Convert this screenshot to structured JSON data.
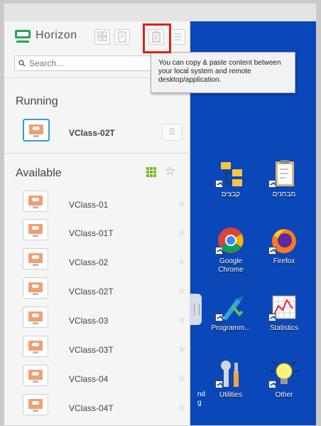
{
  "brand": {
    "name": "Horizon"
  },
  "search": {
    "placeholder": "Search..."
  },
  "tooltip": {
    "text": "You can copy & paste content between your local system and remote desktop/application."
  },
  "sections": {
    "running": "Running",
    "available": "Available"
  },
  "running_items": [
    {
      "label": "VClass-02T"
    }
  ],
  "available_items": [
    {
      "label": "VClass-01"
    },
    {
      "label": "VClass-01T"
    },
    {
      "label": "VClass-02"
    },
    {
      "label": "VClass-02T"
    },
    {
      "label": "VClass-03"
    },
    {
      "label": "VClass-03T"
    },
    {
      "label": "VClass-04"
    },
    {
      "label": "VClass-04T"
    }
  ],
  "desktop_icons": [
    {
      "label": "קבצים",
      "icon": "folder-tree-icon"
    },
    {
      "label": "מבחנים",
      "icon": "clipboard-icon"
    },
    {
      "label": "Google Chrome",
      "icon": "chrome-icon"
    },
    {
      "label": "Firefox",
      "icon": "firefox-icon"
    },
    {
      "label": "Programm...",
      "icon": "programs-icon"
    },
    {
      "label": "Statistics",
      "icon": "statistics-icon"
    },
    {
      "label": "Utilities",
      "icon": "utilities-icon"
    },
    {
      "label": "Other",
      "icon": "lightbulb-icon"
    }
  ],
  "desktop_partial_text": {
    "line1": "nd",
    "line2": "g"
  },
  "colors": {
    "desktop": "#0a47b8",
    "highlight": "#e0201a",
    "selected_border": "#3b9ad4",
    "logo": "#27a35a"
  }
}
